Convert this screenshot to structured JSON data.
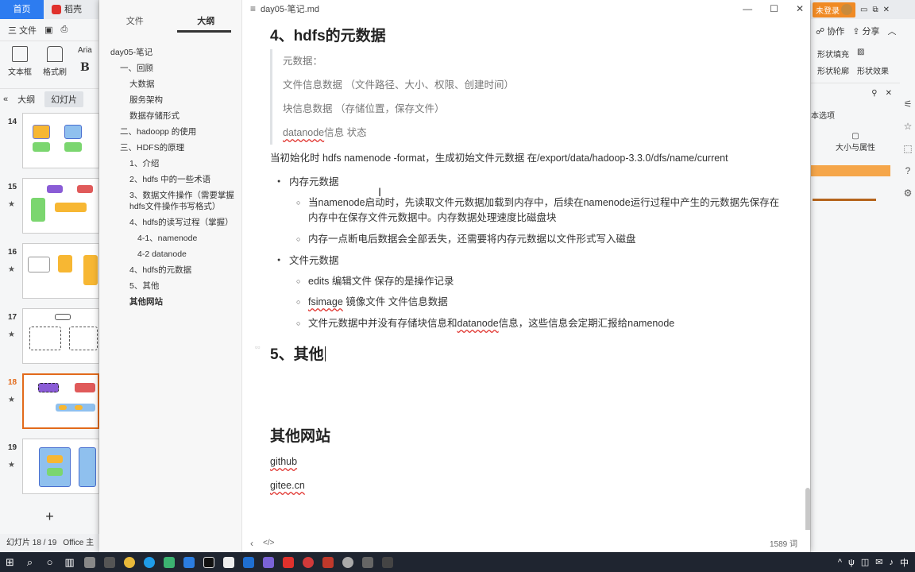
{
  "wps": {
    "tab_home": "首页",
    "tab_doc": "稻壳",
    "menu_file": "三 文件",
    "ribbon": {
      "textbox": "文本框",
      "format_painter": "格式刷",
      "font": "Aria",
      "bold": "B"
    },
    "view_tabs": [
      "大纲",
      "幻灯片"
    ],
    "slides": [
      {
        "num": "14",
        "star": ""
      },
      {
        "num": "15",
        "star": "★"
      },
      {
        "num": "16",
        "star": "★"
      },
      {
        "num": "17",
        "star": "★"
      },
      {
        "num": "18",
        "star": "★"
      },
      {
        "num": "19",
        "star": "★"
      }
    ],
    "add_slide": "+",
    "status_slide": "幻灯片 18 / 19",
    "status_theme": "Office 主",
    "right": {
      "login": "未登录",
      "collab": "协作",
      "share": "分享",
      "shape_fill": "形状填充",
      "shape_outline": "形状轮廓",
      "shape_effect": "形状效果",
      "pane_title": "本选项",
      "size_attr": "大小与属性"
    }
  },
  "typora": {
    "doc_title": "day05-笔记.md",
    "sidebar_tabs": [
      "文件",
      "大纲"
    ],
    "outline": [
      {
        "text": "day05-笔记",
        "level": 0
      },
      {
        "text": "一、回顾",
        "level": 1
      },
      {
        "text": "大数据",
        "level": 2
      },
      {
        "text": "服务架构",
        "level": 2
      },
      {
        "text": "数据存储形式",
        "level": 2
      },
      {
        "text": "二、hadoopp 的使用",
        "level": 1
      },
      {
        "text": "三、HDFS的原理",
        "level": 1
      },
      {
        "text": "1、介绍",
        "level": 2
      },
      {
        "text": "2、hdfs 中的一些术语",
        "level": 2
      },
      {
        "text": "3、数据文件操作（需要掌握hdfs文件操作书写格式）",
        "level": 2
      },
      {
        "text": "4、hdfs的读写过程（掌握）",
        "level": 2
      },
      {
        "text": "4-1、namenode",
        "level": 3
      },
      {
        "text": "4-2 datanode",
        "level": 3
      },
      {
        "text": "4、hdfs的元数据",
        "level": 2
      },
      {
        "text": "5、其他",
        "level": 2
      },
      {
        "text": "其他网站",
        "level": 2
      }
    ],
    "heading_meta": "4、hdfs的元数据",
    "quote": {
      "line1": "元数据：",
      "line2": "文件信息数据   （文件路径、大小、权限、创建时间）",
      "line3": "块信息数据   （存储位置，保存文件）",
      "line4_link": "datanode",
      "line4_rest": "信息  状态"
    },
    "para_init": "当初始化时 hdfs  namenode  -format，生成初始文件元数据 在/export/data/hadoop-3.3.0/dfs/name/current",
    "mem_meta": "内存元数据",
    "mem_1": "当namenode启动时，先读取文件元数据加载到内存中，后续在namenode运行过程中产生的元数据先保存在内存中在保存文件元数据中。内存数据处理速度比磁盘块",
    "mem_2": "内存一点断电后数据会全部丢失，还需要将内存元数据以文件形式写入磁盘",
    "file_meta": "文件元数据",
    "file_1": "edits       编辑文件   保存的是操作记录",
    "file_2_link": "fsimage",
    "file_2_rest": "  镜像文件  文件信息数据",
    "file_3_pre": "文件元数据中并没有存储块信息和",
    "file_3_link": "datanode",
    "file_3_post": "信息，这些信息会定期汇报给namenode",
    "heading_other": "5、其他",
    "heading_sites": "其他网站",
    "link_github": "github",
    "link_gitee": "gitee.cn",
    "word_count": "1589 词"
  },
  "taskbar": {
    "tray_lang": "中",
    "tray_items": [
      "^",
      "ψ",
      "◫",
      "✉",
      "♪"
    ]
  }
}
